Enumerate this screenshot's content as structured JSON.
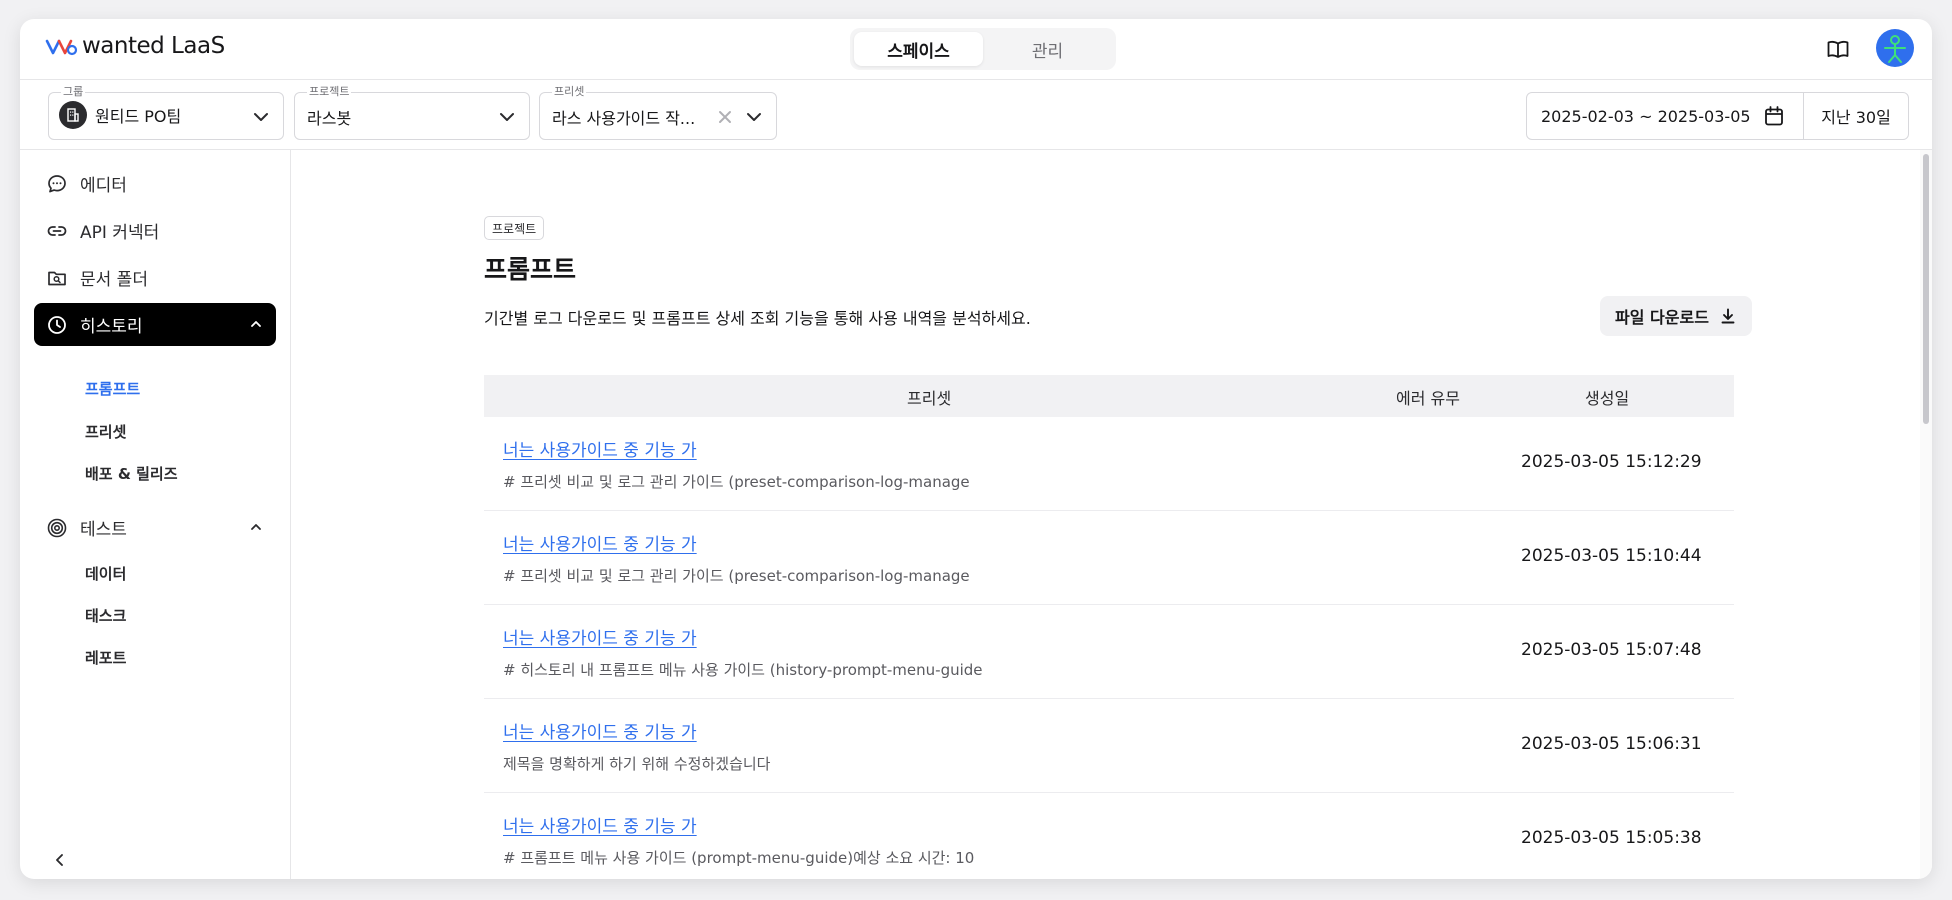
{
  "app": {
    "logo_text": "wanted LaaS",
    "tabs": [
      {
        "label": "스페이스",
        "active": true
      },
      {
        "label": "관리",
        "active": false
      }
    ]
  },
  "filters": {
    "group": {
      "label": "그룹",
      "value": "원티드 PO팀"
    },
    "project": {
      "label": "프로젝트",
      "value": "라스봇"
    },
    "preset": {
      "label": "프리셋",
      "value": "라스 사용가이드 작..."
    },
    "date_range": "2025-02-03 ~ 2025-03-05",
    "period_button": "지난 30일"
  },
  "sidebar": {
    "items": [
      {
        "label": "에디터",
        "icon": "chat-bubble-icon"
      },
      {
        "label": "API 커넥터",
        "icon": "link-icon"
      },
      {
        "label": "문서 폴더",
        "icon": "folder-search-icon"
      },
      {
        "label": "히스토리",
        "icon": "clock-icon",
        "active": true,
        "expanded": true
      },
      {
        "label": "테스트",
        "icon": "target-icon",
        "expanded": true
      }
    ],
    "history_sub": [
      {
        "label": "프롬프트",
        "active": true
      },
      {
        "label": "프리셋"
      },
      {
        "label": "배포 & 릴리즈"
      }
    ],
    "test_sub": [
      {
        "label": "데이터"
      },
      {
        "label": "태스크"
      },
      {
        "label": "레포트"
      }
    ]
  },
  "main": {
    "chip": "프로젝트",
    "title": "프롬프트",
    "description": "기간별 로그 다운로드 및 프롬프트 상세 조회 기능을 통해 사용 내역을 분석하세요.",
    "download_button": "파일 다운로드",
    "table": {
      "headers": {
        "preset": "프리셋",
        "error": "에러 유무",
        "created": "생성일"
      },
      "rows": [
        {
          "title": "너는 사용가이드 중 기능 가",
          "desc": "# 프리셋 비교 및 로그 관리 가이드 (preset-comparison-log-manage",
          "date": "2025-03-05 15:12:29"
        },
        {
          "title": "너는 사용가이드 중 기능 가",
          "desc": "# 프리셋 비교 및 로그 관리 가이드 (preset-comparison-log-manage",
          "date": "2025-03-05 15:10:44"
        },
        {
          "title": "너는 사용가이드 중 기능 가",
          "desc": "# 히스토리 내 프롬프트 메뉴 사용 가이드 (history-prompt-menu-guide",
          "date": "2025-03-05 15:07:48"
        },
        {
          "title": "너는 사용가이드 중 기능 가",
          "desc": "제목을 명확하게 하기 위해 수정하겠습니다",
          "date": "2025-03-05 15:06:31"
        },
        {
          "title": "너는 사용가이드 중 기능 가",
          "desc": "# 프롬프트 메뉴 사용 가이드 (prompt-menu-guide)예상 소요 시간: 10",
          "date": "2025-03-05 15:05:38"
        }
      ]
    }
  },
  "colors": {
    "accent": "#2f6fed",
    "active_nav_bg": "#000000"
  }
}
